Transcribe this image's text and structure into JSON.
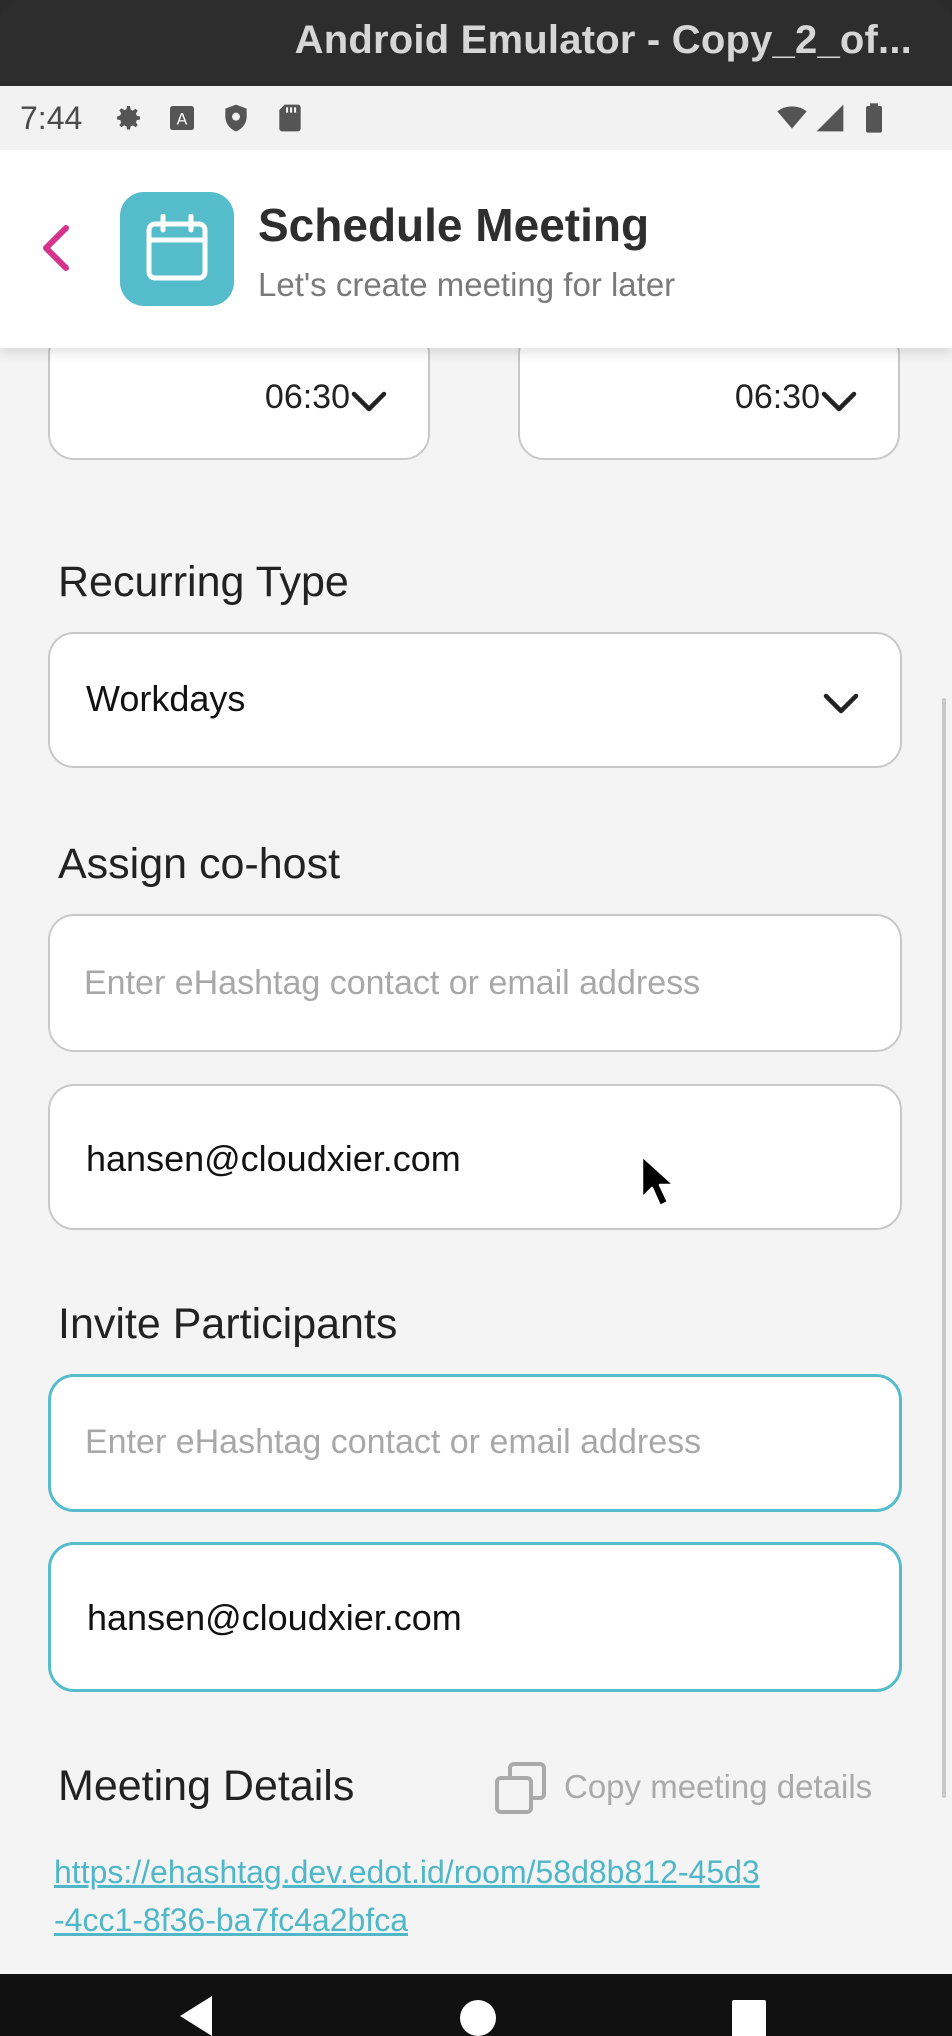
{
  "window": {
    "title": "Android Emulator - Copy_2_of..."
  },
  "status_bar": {
    "time": "7:44"
  },
  "header": {
    "title": "Schedule Meeting",
    "subtitle": "Let's create meeting for later"
  },
  "time_fields": [
    {
      "value": "06:30"
    },
    {
      "value": "06:30"
    }
  ],
  "recurring": {
    "label": "Recurring Type",
    "selected": "Workdays"
  },
  "cohost": {
    "label": "Assign co-host",
    "placeholder": "Enter eHashtag contact or email address",
    "entries": [
      "hansen@cloudxier.com"
    ]
  },
  "participants": {
    "label": "Invite Participants",
    "placeholder": "Enter eHashtag contact or email address",
    "entries": [
      "hansen@cloudxier.com"
    ]
  },
  "meeting_details": {
    "label": "Meeting Details",
    "copy_label": "Copy meeting details",
    "link_line1": "https://ehashtag.dev.edot.id/room/58d8b812-45d3",
    "link_line2": "-4cc1-8f36-ba7fc4a2bfca"
  },
  "colors": {
    "accent": "#55bccb",
    "back_arrow": "#d6348c"
  }
}
